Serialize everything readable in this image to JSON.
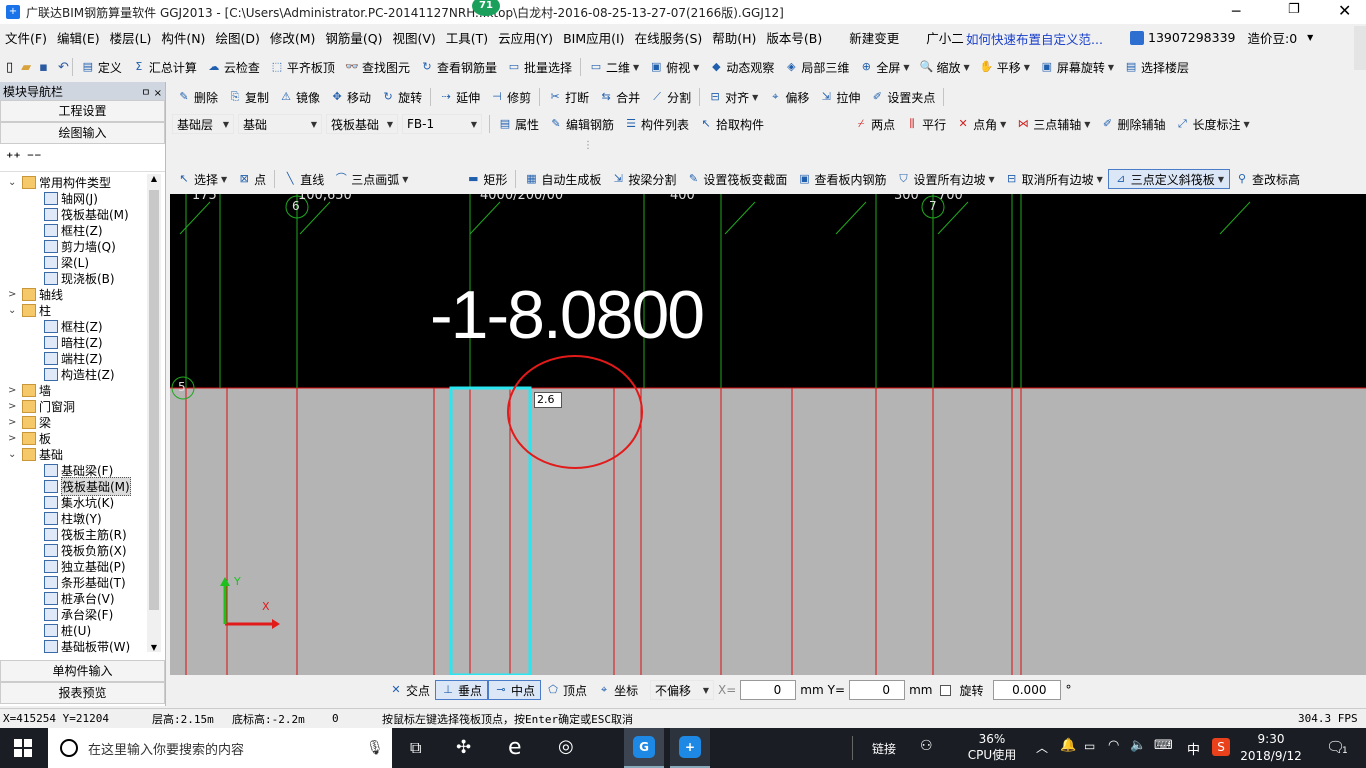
{
  "title_bar": {
    "text": "广联达BIM钢筋算量软件 GGJ2013 - [C:\\Users\\Administrator.PC-20141127NRH...ktop\\白龙村-2016-08-25-13-27-07(2166版).GGJ12]",
    "badge": "71"
  },
  "menu": [
    "文件(F)",
    "编辑(E)",
    "楼层(L)",
    "构件(N)",
    "绘图(D)",
    "修改(M)",
    "钢筋量(Q)",
    "视图(V)",
    "工具(T)",
    "云应用(Y)",
    "BIM应用(I)",
    "在线服务(S)",
    "帮助(H)",
    "版本号(B)",
    "新建变更",
    "广小二"
  ],
  "menu_link": "如何快速布置自定义范...",
  "account": {
    "phone": "13907298339",
    "beans": "造价豆:0"
  },
  "toolbar1": [
    "定义",
    "汇总计算",
    "云检查",
    "平齐板顶",
    "查找图元",
    "查看钢筋量",
    "批量选择",
    "二维",
    "俯视",
    "动态观察",
    "局部三维",
    "全屏",
    "缩放",
    "平移",
    "屏幕旋转",
    "选择楼层"
  ],
  "toolbar2": [
    "删除",
    "复制",
    "镜像",
    "移动",
    "旋转",
    "延伸",
    "修剪",
    "打断",
    "合并",
    "分割",
    "对齐",
    "偏移",
    "拉伸",
    "设置夹点"
  ],
  "toolbar3": {
    "combos": [
      "基础层",
      "基础",
      "筏板基础",
      "FB-1"
    ],
    "items": [
      "属性",
      "编辑钢筋",
      "构件列表",
      "拾取构件",
      "两点",
      "平行",
      "点角",
      "三点辅轴",
      "删除辅轴",
      "长度标注"
    ]
  },
  "toolbar4": [
    "选择",
    "点",
    "直线",
    "三点画弧",
    "矩形",
    "自动生成板",
    "按梁分割",
    "设置筏板变截面",
    "查看板内钢筋",
    "设置所有边坡",
    "取消所有边坡",
    "三点定义斜筏板",
    "查改标高"
  ],
  "nav": {
    "title": "模块导航栏",
    "pin": "ㅁ ×",
    "btn_project": "工程设置",
    "btn_draw": "绘图输入",
    "btn_single": "单构件输入",
    "btn_report": "报表预览",
    "tree": [
      {
        "label": "常用构件类型",
        "level": 0,
        "type": "folder",
        "exp": "⌄"
      },
      {
        "label": "轴网(J)",
        "level": 1,
        "type": "comp"
      },
      {
        "label": "筏板基础(M)",
        "level": 1,
        "type": "comp"
      },
      {
        "label": "框柱(Z)",
        "level": 1,
        "type": "comp"
      },
      {
        "label": "剪力墙(Q)",
        "level": 1,
        "type": "comp"
      },
      {
        "label": "梁(L)",
        "level": 1,
        "type": "comp"
      },
      {
        "label": "现浇板(B)",
        "level": 1,
        "type": "comp"
      },
      {
        "label": "轴线",
        "level": 0,
        "type": "folder",
        "exp": ">"
      },
      {
        "label": "柱",
        "level": 0,
        "type": "folder",
        "exp": "⌄"
      },
      {
        "label": "框柱(Z)",
        "level": 1,
        "type": "comp"
      },
      {
        "label": "暗柱(Z)",
        "level": 1,
        "type": "comp"
      },
      {
        "label": "端柱(Z)",
        "level": 1,
        "type": "comp"
      },
      {
        "label": "构造柱(Z)",
        "level": 1,
        "type": "comp"
      },
      {
        "label": "墙",
        "level": 0,
        "type": "folder",
        "exp": ">"
      },
      {
        "label": "门窗洞",
        "level": 0,
        "type": "folder",
        "exp": ">"
      },
      {
        "label": "梁",
        "level": 0,
        "type": "folder",
        "exp": ">"
      },
      {
        "label": "板",
        "level": 0,
        "type": "folder",
        "exp": ">"
      },
      {
        "label": "基础",
        "level": 0,
        "type": "folder",
        "exp": "⌄"
      },
      {
        "label": "基础梁(F)",
        "level": 1,
        "type": "comp"
      },
      {
        "label": "筏板基础(M)",
        "level": 1,
        "type": "comp",
        "selected": true
      },
      {
        "label": "集水坑(K)",
        "level": 1,
        "type": "comp"
      },
      {
        "label": "柱墩(Y)",
        "level": 1,
        "type": "comp"
      },
      {
        "label": "筏板主筋(R)",
        "level": 1,
        "type": "comp"
      },
      {
        "label": "筏板负筋(X)",
        "level": 1,
        "type": "comp"
      },
      {
        "label": "独立基础(P)",
        "level": 1,
        "type": "comp"
      },
      {
        "label": "条形基础(T)",
        "level": 1,
        "type": "comp"
      },
      {
        "label": "桩承台(V)",
        "level": 1,
        "type": "comp"
      },
      {
        "label": "承台梁(F)",
        "level": 1,
        "type": "comp"
      },
      {
        "label": "桩(U)",
        "level": 1,
        "type": "comp"
      },
      {
        "label": "基础板带(W)",
        "level": 1,
        "type": "comp"
      }
    ]
  },
  "canvas": {
    "top_labels": [
      "175",
      "100,650",
      "4000/200/00",
      "400",
      "300",
      "700"
    ],
    "axis_markers": [
      "6",
      "7",
      "5"
    ],
    "elevation": "-1-8.0800",
    "input_value": "2.6",
    "ucs_x": "X",
    "ucs_y": "Y"
  },
  "snap_bar": {
    "items": [
      "交点",
      "垂点",
      "中点",
      "顶点",
      "坐标"
    ],
    "offset": "不偏移",
    "x_label": "X=",
    "x_value": "0",
    "y_label": "Y=",
    "y_value": "0",
    "unit": "mm",
    "rotate": "旋转",
    "angle": "0.000",
    "deg": "°"
  },
  "status": {
    "coords": "X=415254 Y=21204",
    "floor_height": "层高:2.15m",
    "base_height": "底标高:-2.2m",
    "zero": "0",
    "hint": "按鼠标左键选择筏板顶点，按Enter确定或ESC取消",
    "fps": "304.3 FPS"
  },
  "taskbar": {
    "search": "在这里输入你要搜索的内容",
    "link": "链接",
    "cpu_pct": "36%",
    "cpu_label": "CPU使用",
    "ime": "中",
    "time": "9:30",
    "date": "2018/9/12",
    "notif": "1"
  }
}
